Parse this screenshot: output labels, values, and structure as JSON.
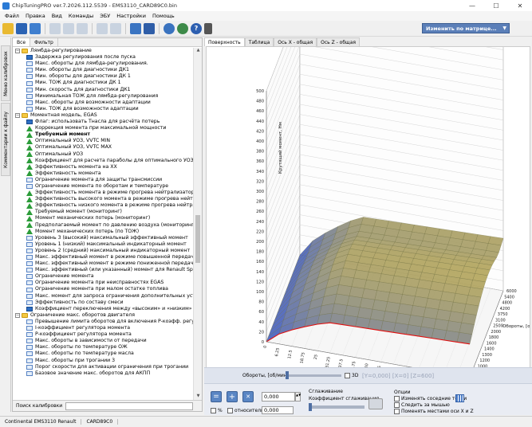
{
  "window": {
    "title": "ChipTuningPRO ver.7.2026.112.5539 - EMS3110_CARD89C0.bin",
    "min": "—",
    "max": "☐",
    "close": "✕"
  },
  "menu": [
    "Файл",
    "Правка",
    "Вид",
    "Команды",
    "ЭБУ",
    "Настройки",
    "Помощь"
  ],
  "toolbar": {
    "matrix_button": "Изменить по матрице...",
    "dd": "▼"
  },
  "sidebar_tabs": [
    "Меню калибровок",
    "Комментарии к файлу"
  ],
  "left_tabs": [
    "Все",
    "Фильтр"
  ],
  "tree": [
    {
      "t": "Лямбда-регулирование",
      "lv": 0,
      "k": "folder",
      "exp": "−"
    },
    {
      "t": "Задержка регулирования после пуска",
      "lv": 1,
      "k": "flag"
    },
    {
      "t": "Макс. обороты для лямбда-регулирования.",
      "lv": 1,
      "k": "tbl"
    },
    {
      "t": "Мин. обороты для диагностики ДК1",
      "lv": 1,
      "k": "tbl"
    },
    {
      "t": "Мин. обороты для диагностики ДК 1",
      "lv": 1,
      "k": "tbl"
    },
    {
      "t": "Мин. ТОЖ для диагностики ДК 1",
      "lv": 1,
      "k": "tbl"
    },
    {
      "t": "Мин. скорость для диагностики ДК1",
      "lv": 1,
      "k": "tbl"
    },
    {
      "t": "Минимальная ТОЖ для лямбда-регулирования",
      "lv": 1,
      "k": "tbl"
    },
    {
      "t": "Макс. обороты для возможности адаптации",
      "lv": 1,
      "k": "tbl"
    },
    {
      "t": "Мин. ТОЖ для возможности адаптации",
      "lv": 1,
      "k": "tbl"
    },
    {
      "t": "Моментная модель, EGAS",
      "lv": 0,
      "k": "folder",
      "exp": "−"
    },
    {
      "t": "Флаг: использовать Тнасла для расчёта потерь",
      "lv": 1,
      "k": "flag"
    },
    {
      "t": "Коррекция момента при максимальной мощности",
      "lv": 1,
      "k": "m3d"
    },
    {
      "t": "Требуемый момент",
      "lv": 1,
      "k": "m3d",
      "sel": true
    },
    {
      "t": "Оптимальный УОЗ, VVTC MIN",
      "lv": 1,
      "k": "m3d"
    },
    {
      "t": "Оптимальный УОЗ, VVTC MAX",
      "lv": 1,
      "k": "m3d"
    },
    {
      "t": "Оптимальный УОЗ",
      "lv": 1,
      "k": "m3d"
    },
    {
      "t": "Коэффициент для расчета параболы для оптимального УОЗ",
      "lv": 1,
      "k": "m3d"
    },
    {
      "t": "Эффективность момента на XX",
      "lv": 1,
      "k": "m3d"
    },
    {
      "t": "Эффективность момента",
      "lv": 1,
      "k": "m3d"
    },
    {
      "t": "Ограничение момента для защиты трансмиссии",
      "lv": 1,
      "k": "tbl"
    },
    {
      "t": "Ограничение момента по оборотам и температуре",
      "lv": 1,
      "k": "tbl"
    },
    {
      "t": "Эффективность момента в режиме прогрева нейтрализатора",
      "lv": 1,
      "k": "m3d"
    },
    {
      "t": "Эффективность высокого момента в режиме прогрева нейтра",
      "lv": 1,
      "k": "m3d"
    },
    {
      "t": "Эффективность низкого момента в режиме прогрева нейтрал",
      "lv": 1,
      "k": "m3d"
    },
    {
      "t": "Требуемый момент (мониторинг)",
      "lv": 1,
      "k": "m3d"
    },
    {
      "t": "Момент механических потерь (мониторинг)",
      "lv": 1,
      "k": "m3d"
    },
    {
      "t": "Предполагаемый момент по давлению воздуха (мониторинг)",
      "lv": 1,
      "k": "m3d"
    },
    {
      "t": "Момент механических потерь (по ТОЖ)",
      "lv": 1,
      "k": "m3d"
    },
    {
      "t": "Уровень 3 (высокий) максимальный эффективный момент",
      "lv": 1,
      "k": "tbl"
    },
    {
      "t": "Уровень 1 (низкий) максимальный индикаторный момент",
      "lv": 1,
      "k": "tbl"
    },
    {
      "t": "Уровень 2 (средний) максимальный индикаторный момент",
      "lv": 1,
      "k": "tbl"
    },
    {
      "t": "Макс. эффективный момент в режиме повышенной передачи",
      "lv": 1,
      "k": "tbl"
    },
    {
      "t": "Макс. эффективный момент в режиме пониженной передачи",
      "lv": 1,
      "k": "tbl"
    },
    {
      "t": "Макс. эффективный (или указанный) момент для Renault Sport",
      "lv": 1,
      "k": "tbl"
    },
    {
      "t": "Ограничение момента",
      "lv": 1,
      "k": "tbl"
    },
    {
      "t": "Ограничение момента при неисправностях EGAS",
      "lv": 1,
      "k": "tbl"
    },
    {
      "t": "Ограничение момента при малом остатке топлива",
      "lv": 1,
      "k": "tbl"
    },
    {
      "t": "Макс. момент для запроса ограничения дополнительных устро",
      "lv": 1,
      "k": "tbl"
    },
    {
      "t": "Эффективность по составу смеси",
      "lv": 1,
      "k": "tbl"
    },
    {
      "t": "Коэффициент переключения между «высоким» и «низким»",
      "lv": 1,
      "k": "flag"
    },
    {
      "t": "Ограничение макс. оборотов двигателя",
      "lv": 0,
      "k": "folder",
      "exp": "−"
    },
    {
      "t": "Превышение лимита оборотов для включения P-коэфф. регул",
      "lv": 1,
      "k": "tbl"
    },
    {
      "t": "I-коэффициент регулятора момента",
      "lv": 1,
      "k": "tbl"
    },
    {
      "t": "P-коэффициент регулятора момента",
      "lv": 1,
      "k": "tbl"
    },
    {
      "t": "Макс. обороты  в зависимости от передачи",
      "lv": 1,
      "k": "tbl"
    },
    {
      "t": "Макс. обороты по температуре ОЖ",
      "lv": 1,
      "k": "tbl"
    },
    {
      "t": "Макс. обороты по температуре масла",
      "lv": 1,
      "k": "tbl"
    },
    {
      "t": "Макс. обороты при трогании 3",
      "lv": 1,
      "k": "tbl"
    },
    {
      "t": "Порог скорости для активации ограничения при трогании",
      "lv": 1,
      "k": "tbl"
    },
    {
      "t": "Базовое значение макс. оборотов для АКПП",
      "lv": 1,
      "k": "tbl"
    }
  ],
  "search_label": "Поиск калибровки",
  "main_tabs": [
    "Поверхность",
    "Таблица",
    "Ось X - общая",
    "Ось Z - общая"
  ],
  "chart_data": {
    "type": "surface3d",
    "title": "Требуемый момент",
    "ylabel": "Крутящий момент, Нм",
    "xlabel": "Положение педали акселератора, [%]",
    "zlabel": "Обороты, [об/мин]",
    "y_ticks": [
      "0",
      "20",
      "40",
      "60",
      "80",
      "100",
      "120",
      "140",
      "160",
      "180",
      "200",
      "220",
      "240",
      "260",
      "280",
      "300",
      "320",
      "340",
      "360",
      "380",
      "400",
      "420",
      "440",
      "460",
      "480",
      "500"
    ],
    "x_ticks": [
      "0",
      "6.25",
      "12.5",
      "18.75",
      "25",
      "31.25",
      "37.5",
      "43.75",
      "50",
      "56.25",
      "62.5",
      "68.75",
      "75",
      "81.25",
      "87.5",
      "93.75",
      "100"
    ],
    "z_ticks": [
      "6000",
      "5400",
      "4800",
      "4200",
      "3750",
      "3100",
      "2500",
      "2000",
      "1800",
      "1600",
      "1400",
      "1300",
      "1200",
      "1000",
      "800",
      "600"
    ]
  },
  "controls": {
    "rpm_label": "Обороты, [об/мин]",
    "check_3d": "3D",
    "readout": "[Y=0,000] [X=0] [Z=600]",
    "plus": "+",
    "times": "✕",
    "value": "0,000",
    "pct": "%",
    "relative": "относительно",
    "value2": "0,000",
    "smoothing_title": "Сглаживание",
    "smoothing_coef": "Коэффициент сглаживания",
    "options_title": "Опции",
    "opt1": "Изменять соседние точки",
    "opt2": "Следить за мышью",
    "opt3": "Поменять местами оси X и Z"
  },
  "status": [
    "Continental EMS3110 Renault",
    "CARD89C0"
  ]
}
